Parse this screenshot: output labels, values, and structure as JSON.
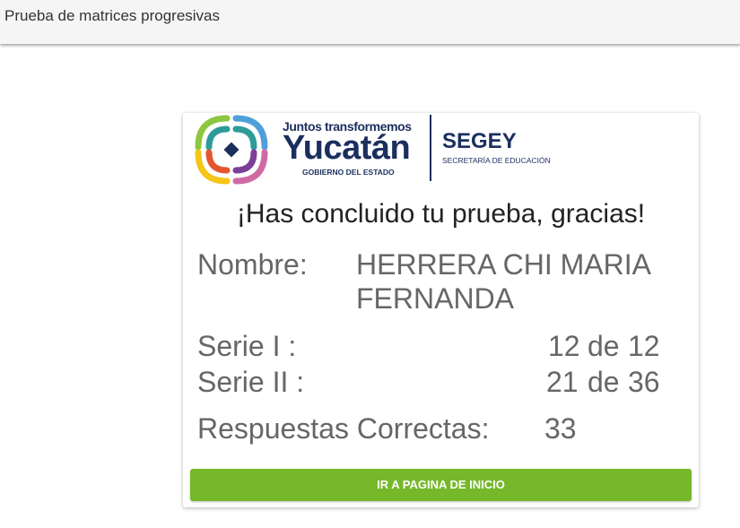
{
  "header": {
    "title": "Prueba de matrices progresivas"
  },
  "logo": {
    "tagline": "Juntos transformemos",
    "name": "Yucatán",
    "subtitle": "GOBIERNO DEL ESTADO",
    "org": "SEGEY",
    "org_sub": "SECRETARÍA DE EDUCACIÓN",
    "colors": [
      "#2e9b9a",
      "#e4572e",
      "#f5c518",
      "#7b3f98",
      "#d06aa5",
      "#4f9fd9",
      "#8dc63f"
    ]
  },
  "result": {
    "heading": "¡Has concluido tu prueba, gracias!",
    "name_label": "Nombre:",
    "name_value": "HERRERA CHI MARIA FERNANDA",
    "serie1_label": "Serie I :",
    "serie1_score": "12",
    "serie1_of": "de",
    "serie1_total": "12",
    "serie2_label": "Serie II :",
    "serie2_score": "21",
    "serie2_of": "de",
    "serie2_total": "36",
    "correct_label": "Respuestas Correctas:",
    "correct_value": "33"
  },
  "actions": {
    "home_button": "IR A PAGINA DE INICIO"
  },
  "theme": {
    "accent": "#76b82a",
    "brand_navy": "#1b2f5e"
  }
}
